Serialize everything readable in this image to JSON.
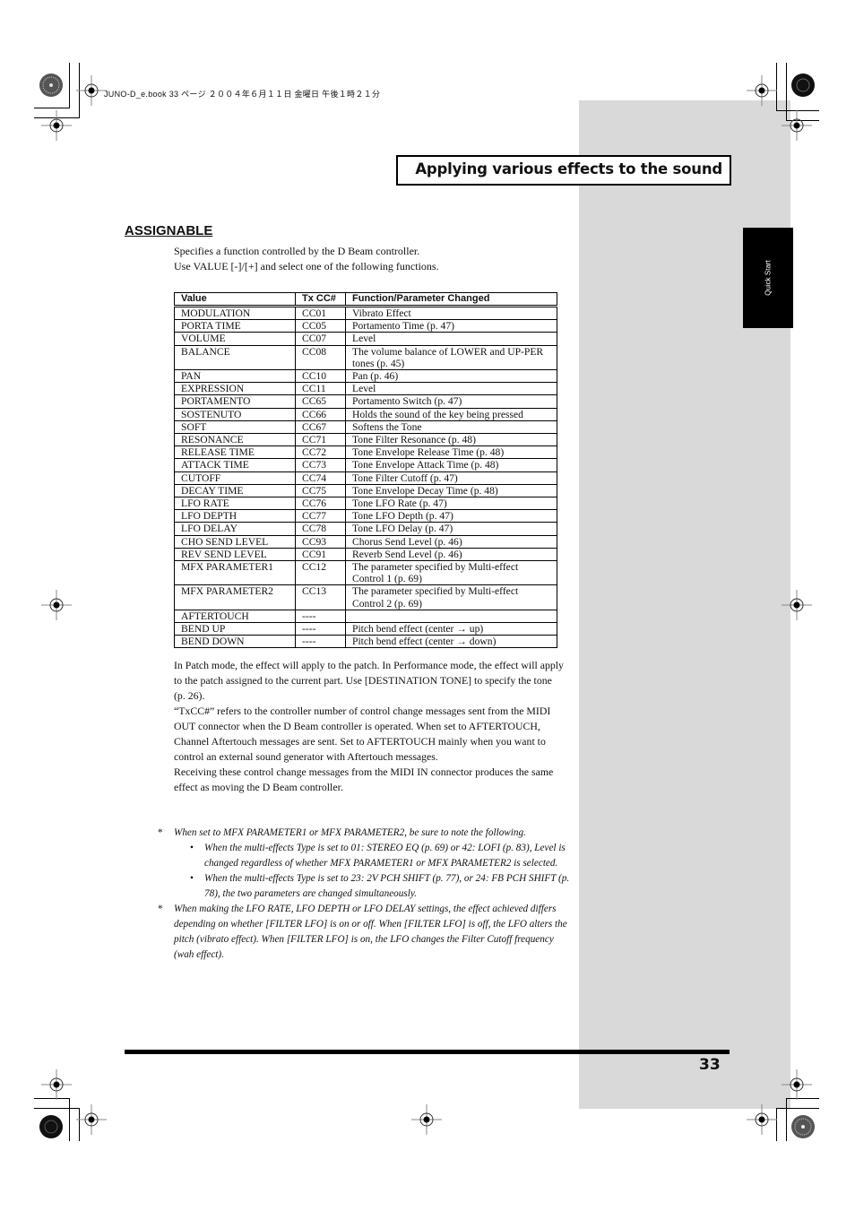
{
  "print_info": "JUNO-D_e.book 33 ページ ２００４年６月１１日 金曜日 午後１時２１分",
  "header": {
    "title": "Applying various effects to the sound"
  },
  "side_tab": {
    "label": "Quick Start"
  },
  "section": {
    "title": "ASSIGNABLE",
    "intro": [
      "Specifies a function controlled by the D Beam controller.",
      "Use VALUE [-]/[+] and select one of the following functions."
    ]
  },
  "table": {
    "headers": [
      "Value",
      "Tx CC#",
      "Function/Parameter Changed"
    ],
    "rows": [
      [
        "MODULATION",
        "CC01",
        "Vibrato Effect"
      ],
      [
        "PORTA TIME",
        "CC05",
        "Portamento Time (p. 47)"
      ],
      [
        "VOLUME",
        "CC07",
        "Level"
      ],
      [
        "BALANCE",
        "CC08",
        "The volume balance of LOWER and UP-PER tones (p. 45)"
      ],
      [
        "PAN",
        "CC10",
        "Pan (p. 46)"
      ],
      [
        "EXPRESSION",
        "CC11",
        "Level"
      ],
      [
        "PORTAMENTO",
        "CC65",
        "Portamento Switch (p. 47)"
      ],
      [
        "SOSTENUTO",
        "CC66",
        "Holds the sound of the key being pressed"
      ],
      [
        "SOFT",
        "CC67",
        "Softens the Tone"
      ],
      [
        "RESONANCE",
        "CC71",
        "Tone Filter Resonance (p. 48)"
      ],
      [
        "RELEASE TIME",
        "CC72",
        "Tone Envelope Release Time (p. 48)"
      ],
      [
        "ATTACK TIME",
        "CC73",
        "Tone Envelope Attack Time (p. 48)"
      ],
      [
        "CUTOFF",
        "CC74",
        "Tone Filter Cutoff (p. 47)"
      ],
      [
        "DECAY TIME",
        "CC75",
        "Tone Envelope Decay Time (p. 48)"
      ],
      [
        "LFO RATE",
        "CC76",
        "Tone LFO Rate (p. 47)"
      ],
      [
        "LFO DEPTH",
        "CC77",
        "Tone LFO Depth (p. 47)"
      ],
      [
        "LFO DELAY",
        "CC78",
        "Tone LFO Delay (p. 47)"
      ],
      [
        "CHO SEND LEVEL",
        "CC93",
        "Chorus Send Level (p. 46)"
      ],
      [
        "REV SEND LEVEL",
        "CC91",
        "Reverb Send Level (p. 46)"
      ],
      [
        "MFX PARAMETER1",
        "CC12",
        "The parameter specified by Multi-effect Control 1 (p. 69)"
      ],
      [
        "MFX PARAMETER2",
        "CC13",
        "The parameter specified by Multi-effect Control 2 (p. 69)"
      ],
      [
        "AFTERTOUCH",
        "----",
        ""
      ],
      [
        "BEND UP",
        "----",
        "Pitch bend effect (center → up)"
      ],
      [
        "BEND DOWN",
        "----",
        "Pitch bend effect (center → down)"
      ]
    ]
  },
  "body_paragraphs": [
    "In Patch mode, the effect will apply to the patch. In Performance mode, the effect will apply to the patch assigned to the current part. Use [DESTINATION TONE] to specify the tone (p. 26).",
    "“TxCC#” refers to the controller number of control change messages sent from the MIDI OUT connector when the D Beam controller is operated. When set to AFTERTOUCH, Channel Aftertouch messages are sent. Set to AFTERTOUCH mainly when you want to control an external sound generator with Aftertouch messages.",
    "Receiving these control change messages from the MIDI IN connector produces the same effect as moving the D Beam controller."
  ],
  "notes": {
    "note1": {
      "marker": "*",
      "text": "When set to MFX PARAMETER1 or MFX PARAMETER2, be sure to note the following.",
      "bullets": [
        "When the multi-effects Type is set to 01: STEREO EQ (p. 69) or 42: LOFI (p. 83), Level is changed regardless of whether MFX PARAMETER1 or MFX PARAMETER2 is selected.",
        "When the multi-effects Type is set to 23: 2V PCH SHIFT (p. 77), or 24: FB PCH SHIFT (p. 78), the two parameters are changed simultaneously."
      ]
    },
    "note2": {
      "marker": "*",
      "text": "When making the LFO RATE, LFO DEPTH or LFO DELAY settings, the effect achieved differs depending on whether [FILTER LFO] is on or off. When [FILTER LFO] is off, the LFO alters the pitch (vibrato effect). When [FILTER LFO] is on, the LFO changes the Filter Cutoff frequency (wah effect)."
    }
  },
  "bullet_glyph": "•",
  "page_number": "33"
}
